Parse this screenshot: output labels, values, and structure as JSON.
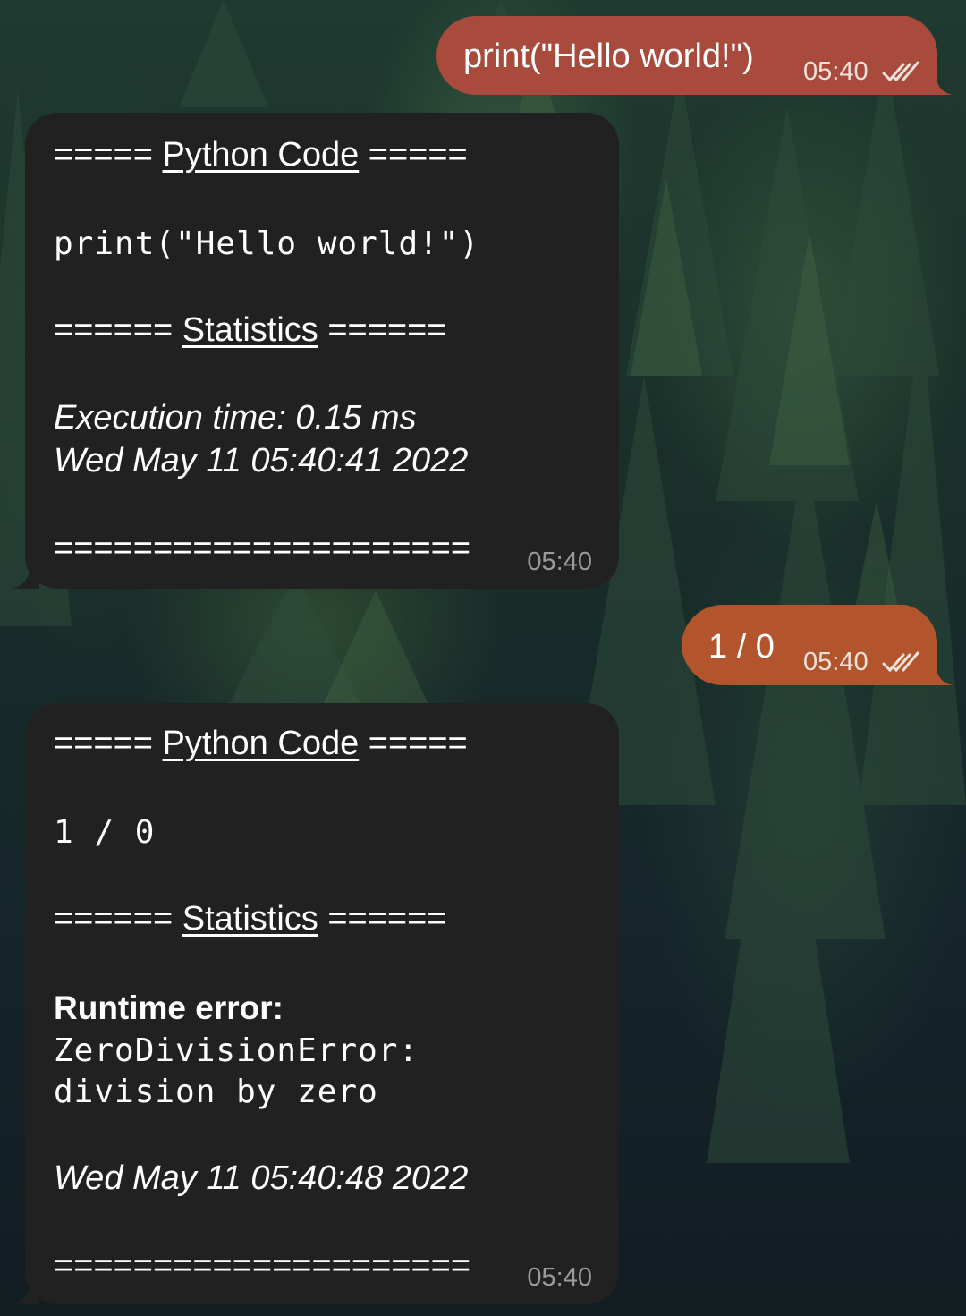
{
  "messages": {
    "out1": {
      "text": "print(\"Hello world!\")",
      "time": "05:40",
      "color": "#a84a3c"
    },
    "in1": {
      "code_header_pre": "===== ",
      "code_header_label": "Python Code",
      "code_header_post": " =====",
      "code": "print(\"Hello world!\")",
      "stats_header_pre": "====== ",
      "stats_header_label": "Statistics",
      "stats_header_post": " ======",
      "execution": "Execution time: 0.15 ms",
      "date": "Wed May 11 05:40:41 2022",
      "footer": "=====================",
      "time": "05:40"
    },
    "out2": {
      "text": "1 / 0",
      "time": "05:40",
      "color": "#b3552c"
    },
    "in2": {
      "code_header_pre": "===== ",
      "code_header_label": "Python Code",
      "code_header_post": " =====",
      "code": "1 / 0",
      "stats_header_pre": "====== ",
      "stats_header_label": "Statistics",
      "stats_header_post": " ======",
      "error_label": "Runtime error:",
      "error_line1": "ZeroDivisionError:",
      "error_line2": "division by zero",
      "date": "Wed May 11 05:40:48 2022",
      "footer": "=====================",
      "time": "05:40"
    }
  },
  "icons": {
    "read_receipt": "double-check-icon"
  },
  "colors": {
    "incoming_bubble": "#212121",
    "incoming_time": "#9a9a9a"
  }
}
